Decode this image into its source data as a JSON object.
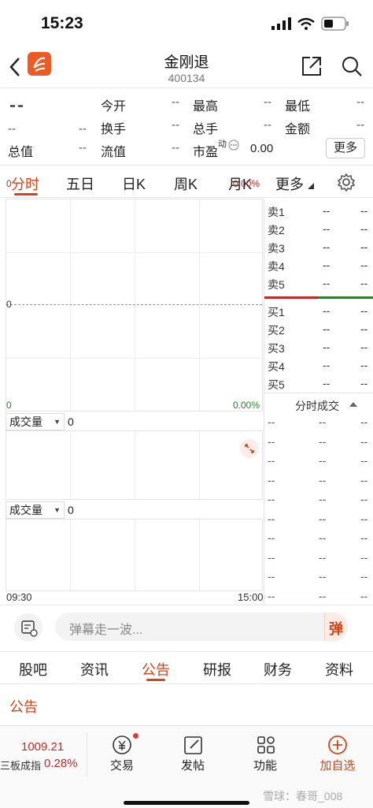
{
  "status_bar": {
    "time": "15:23"
  },
  "header": {
    "name": "金刚退",
    "code": "400134"
  },
  "quote": {
    "price": "--",
    "change": "--",
    "change_pct": "--",
    "fields": [
      {
        "label": "今开",
        "value": "--"
      },
      {
        "label": "最高",
        "value": "--"
      },
      {
        "label": "最低",
        "value": "--"
      },
      {
        "label": "换手",
        "value": "--"
      },
      {
        "label": "总手",
        "value": "--"
      },
      {
        "label": "金额",
        "value": "--"
      },
      {
        "label": "总值",
        "value": "--"
      },
      {
        "label": "流值",
        "value": "--"
      },
      {
        "label": "市盈",
        "value": "0.00"
      }
    ],
    "pe_sup": "动",
    "more_button": "更多"
  },
  "chart_tabs": [
    "分时",
    "五日",
    "日K",
    "周K",
    "月K",
    "更多"
  ],
  "chart": {
    "top_left": "0",
    "top_right": "0.00%",
    "mid_left": "0",
    "bottom_left": "0",
    "bottom_right": "0.00%",
    "volume1_label": "成交量",
    "volume1_value": "0",
    "volume2_label": "成交量",
    "volume2_value": "0",
    "time_start": "09:30",
    "time_end": "15:00"
  },
  "order_book": {
    "sells": [
      {
        "label": "卖5",
        "p": "--",
        "v": "--"
      },
      {
        "label": "卖4",
        "p": "--",
        "v": "--"
      },
      {
        "label": "卖3",
        "p": "--",
        "v": "--"
      },
      {
        "label": "卖2",
        "p": "--",
        "v": "--"
      },
      {
        "label": "卖1",
        "p": "--",
        "v": "--"
      }
    ],
    "buys": [
      {
        "label": "买1",
        "p": "--",
        "v": "--"
      },
      {
        "label": "买2",
        "p": "--",
        "v": "--"
      },
      {
        "label": "买3",
        "p": "--",
        "v": "--"
      },
      {
        "label": "买4",
        "p": "--",
        "v": "--"
      },
      {
        "label": "买5",
        "p": "--",
        "v": "--"
      }
    ],
    "trades_title": "分时成交",
    "trade_rows": [
      {
        "t": "--",
        "p": "--",
        "v": "--"
      },
      {
        "t": "--",
        "p": "--",
        "v": "--"
      },
      {
        "t": "--",
        "p": "--",
        "v": "--"
      },
      {
        "t": "--",
        "p": "--",
        "v": "--"
      },
      {
        "t": "--",
        "p": "--",
        "v": "--"
      },
      {
        "t": "--",
        "p": "--",
        "v": "--"
      },
      {
        "t": "--",
        "p": "--",
        "v": "--"
      },
      {
        "t": "--",
        "p": "--",
        "v": "--"
      },
      {
        "t": "--",
        "p": "--",
        "v": "--"
      },
      {
        "t": "--",
        "p": "--",
        "v": "--"
      }
    ]
  },
  "danmaku": {
    "placeholder": "弹幕走一波...",
    "badge": "弹"
  },
  "sub_tabs": [
    "股吧",
    "资讯",
    "公告",
    "研报",
    "财务",
    "资料"
  ],
  "section_title": "公告",
  "bottom_bar": {
    "index_value": "1009.21",
    "index_name": "三板成指",
    "index_change": "0.28%",
    "items": [
      "交易",
      "发帖",
      "功能",
      "加自选"
    ]
  },
  "watermark": "雪球：春哥_008",
  "colors": {
    "accent": "#d84315",
    "up": "#c62828",
    "down": "#2e7d32"
  }
}
